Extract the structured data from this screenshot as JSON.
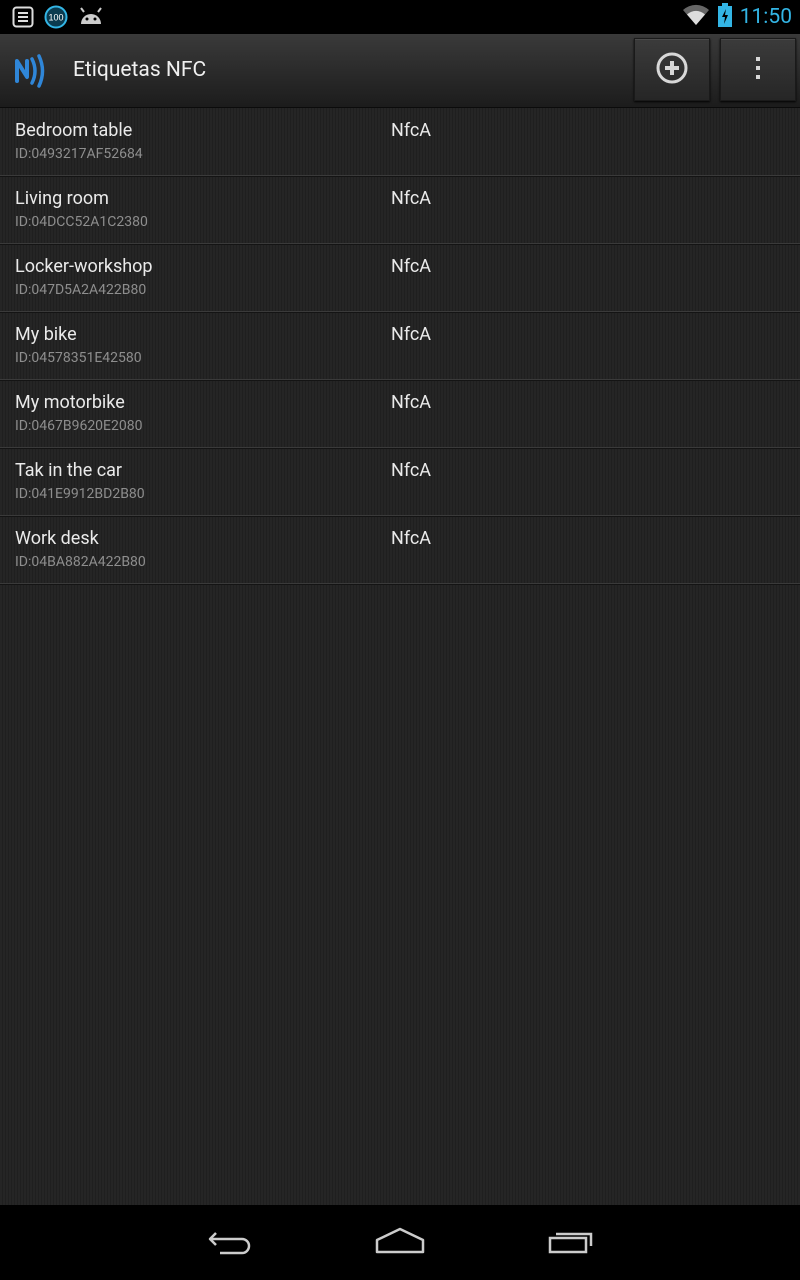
{
  "status_bar": {
    "time": "11:50",
    "notification_badge": "100",
    "icons": [
      "notes-icon",
      "badge-100-icon",
      "android-icon",
      "wifi-icon",
      "battery-charging-icon"
    ],
    "accent_color": "#33b5e5"
  },
  "action_bar": {
    "title": "Etiquetas NFC",
    "app_icon": "nfc-icon",
    "add_button_icon": "add-circle-icon",
    "overflow_button_icon": "overflow-menu-icon"
  },
  "tags": [
    {
      "name": "Bedroom table",
      "id": "ID:0493217AF52684",
      "type": "NfcA"
    },
    {
      "name": "Living room",
      "id": "ID:04DCC52A1C2380",
      "type": "NfcA"
    },
    {
      "name": "Locker-workshop",
      "id": "ID:047D5A2A422B80",
      "type": "NfcA"
    },
    {
      "name": "My bike",
      "id": "ID:04578351E42580",
      "type": "NfcA"
    },
    {
      "name": "My motorbike",
      "id": "ID:0467B9620E2080",
      "type": "NfcA"
    },
    {
      "name": "Tak in the car",
      "id": "ID:041E9912BD2B80",
      "type": "NfcA"
    },
    {
      "name": "Work desk",
      "id": "ID:04BA882A422B80",
      "type": "NfcA"
    }
  ],
  "nav_bar": {
    "back_icon": "back-icon",
    "home_icon": "home-icon",
    "recents_icon": "recents-icon"
  }
}
